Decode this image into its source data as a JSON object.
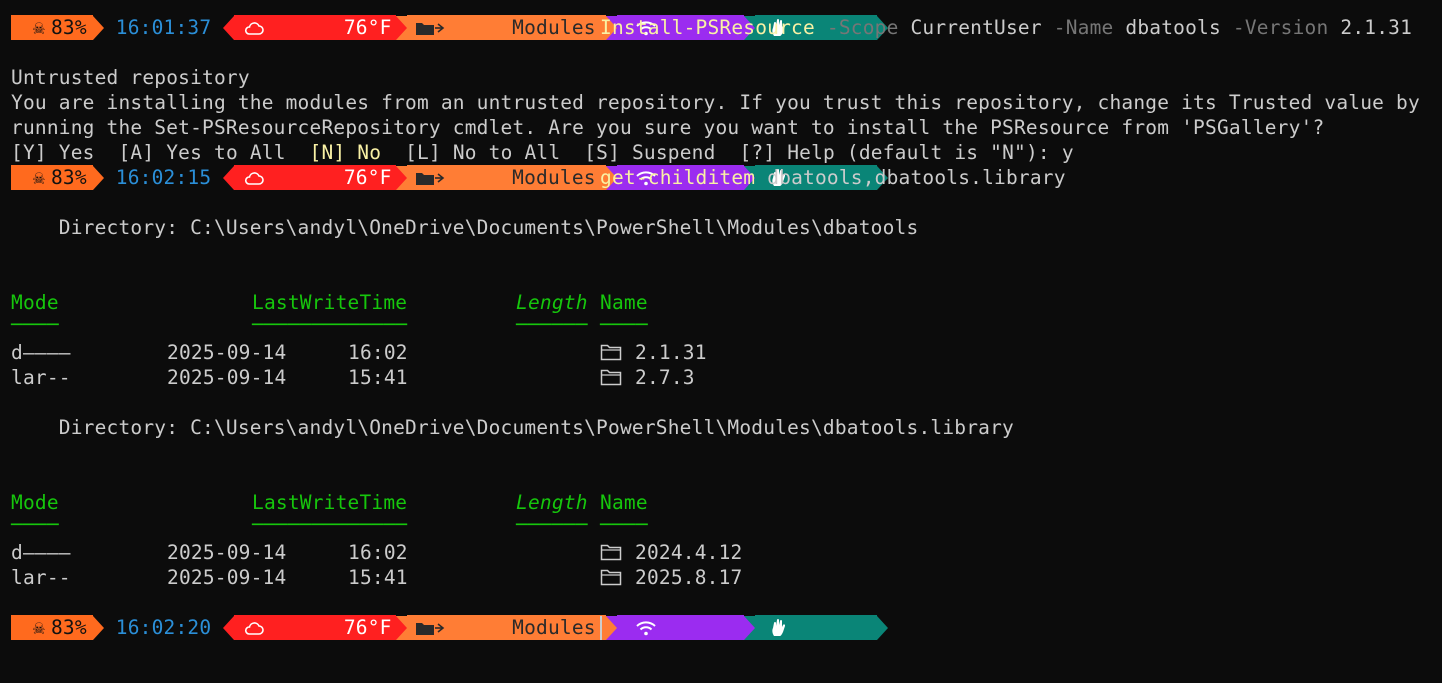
{
  "colors": {
    "background": "#0c0c0c",
    "foreground": "#cccccc",
    "battery_segment": "#ff6a1e",
    "time_text": "#2b8fd8",
    "weather_segment": "#ff2020",
    "dir_segment": "#ff7d35",
    "wifi_segment": "#9b2cf0",
    "hand_segment": "#0a8577",
    "command_yellow": "#f9f1a5",
    "header_green": "#16c60c"
  },
  "prompts": [
    {
      "battery": "83%",
      "time": "16:01:37",
      "weather": "76°F",
      "dir": "Modules"
    },
    {
      "battery": "83%",
      "time": "16:02:15",
      "weather": "76°F",
      "dir": "Modules"
    },
    {
      "battery": "83%",
      "time": "16:02:20",
      "weather": "76°F",
      "dir": "Modules"
    }
  ],
  "cmd1": {
    "name": "Install-PSResource",
    "p1": "-Scope",
    "v1": "CurrentUser",
    "p2": "-Name",
    "v2": "dbatools",
    "p3": "-Version",
    "v3": "2.1.31"
  },
  "warning": {
    "title": "Untrusted repository",
    "line1": "You are installing the modules from an untrusted repository. If you trust this repository, change its Trusted value by",
    "line2": "running the Set-PSResourceRepository cmdlet. Are you sure you want to install the PSResource from 'PSGallery'?",
    "opt_y": "[Y] Yes",
    "opt_a": "[A] Yes to All",
    "opt_n": "[N] No",
    "opt_l": "[L] No to All",
    "opt_s": "[S] Suspend",
    "opt_help": "[?] Help (default is \"N\"): y"
  },
  "cmd2": {
    "name": "get-childitem",
    "args": "dbatools,dbatools.library"
  },
  "listing1": {
    "directory": "    Directory: C:\\Users\\andyl\\OneDrive\\Documents\\PowerShell\\Modules\\dbatools",
    "headers": {
      "mode": "Mode",
      "lwt": "LastWriteTime",
      "length": "Length",
      "name": "Name"
    },
    "underlines": {
      "mode": "────",
      "lwt": "─────────────",
      "length": "──────",
      "name": "────"
    },
    "rows": [
      {
        "mode": "d————",
        "date": "2025-09-14",
        "time": "16:02",
        "name": "2.1.31"
      },
      {
        "mode": "lar--",
        "date": "2025-09-14",
        "time": "15:41",
        "name": "2.7.3"
      }
    ]
  },
  "listing2": {
    "directory": "    Directory: C:\\Users\\andyl\\OneDrive\\Documents\\PowerShell\\Modules\\dbatools.library",
    "headers": {
      "mode": "Mode",
      "lwt": "LastWriteTime",
      "length": "Length",
      "name": "Name"
    },
    "underlines": {
      "mode": "────",
      "lwt": "─────────────",
      "length": "──────",
      "name": "────"
    },
    "rows": [
      {
        "mode": "d————",
        "date": "2025-09-14",
        "time": "16:02",
        "name": "2024.4.12"
      },
      {
        "mode": "lar--",
        "date": "2025-09-14",
        "time": "15:41",
        "name": "2025.8.17"
      }
    ]
  },
  "icons": [
    "skull-icon",
    "cloud-icon",
    "folder-icon",
    "wifi-icon",
    "hand-icon"
  ]
}
